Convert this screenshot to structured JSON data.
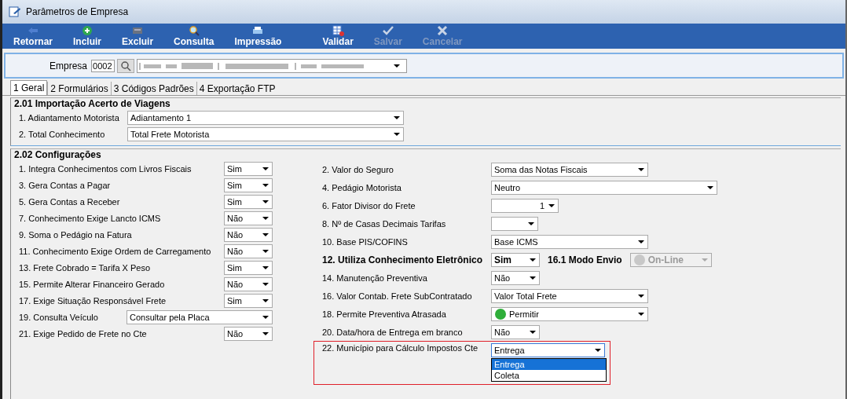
{
  "window": {
    "title": "Parâmetros de Empresa"
  },
  "toolbar": [
    {
      "label": "Retornar",
      "disabled": false
    },
    {
      "label": "Incluir",
      "disabled": false
    },
    {
      "label": "Excluir",
      "disabled": false
    },
    {
      "label": "Consulta",
      "disabled": false
    },
    {
      "label": "Impressão",
      "disabled": false
    },
    {
      "label": "Validar",
      "disabled": false
    },
    {
      "label": "Salvar",
      "disabled": true
    },
    {
      "label": "Cancelar",
      "disabled": true
    }
  ],
  "company": {
    "label": "Empresa",
    "code": "0002"
  },
  "tabs": [
    {
      "label": "1 Geral",
      "selected": true
    },
    {
      "label": "2 Formulários",
      "selected": false
    },
    {
      "label": "3 Códigos Padrões",
      "selected": false
    },
    {
      "label": "4 Exportação FTP",
      "selected": false
    }
  ],
  "import_section": {
    "title": "2.01 Importação Acerto de Viagens",
    "fields": [
      {
        "label": "1. Adiantamento Motorista",
        "value": "Adiantamento 1"
      },
      {
        "label": "2. Total Conhecimento",
        "value": "Total Frete Motorista"
      }
    ]
  },
  "config_section": {
    "title": "2.02 Configurações",
    "left": [
      {
        "label": "1. Integra Conhecimentos com Livros Fiscais",
        "value": "Sim"
      },
      {
        "label": "3. Gera Contas a Pagar",
        "value": "Sim"
      },
      {
        "label": "5. Gera Contas a Receber",
        "value": "Sim"
      },
      {
        "label": "7. Conhecimento Exige Lancto ICMS",
        "value": "Não"
      },
      {
        "label": "9. Soma o Pedágio na Fatura",
        "value": "Não"
      },
      {
        "label": "11. Conhecimento Exige Ordem de Carregamento",
        "value": "Não"
      },
      {
        "label": "13. Frete Cobrado = Tarifa X Peso",
        "value": "Sim"
      },
      {
        "label": "15. Permite Alterar Financeiro Gerado",
        "value": "Não"
      },
      {
        "label": "17. Exige Situação Responsável Frete",
        "value": "Sim"
      },
      {
        "label": "19. Consulta Veículo",
        "value": "Consultar pela Placa"
      },
      {
        "label": "21. Exige Pedido de Frete no Cte",
        "value": "Não"
      }
    ],
    "right": [
      {
        "label": "2. Valor do Seguro",
        "value": "Soma das Notas Fiscais",
        "highlighted": false
      },
      {
        "label": "4. Pedágio Motorista",
        "value": "Neutro",
        "highlighted": false
      },
      {
        "label": "6. Fator Divisor do Frete",
        "value": "1",
        "highlighted": false
      },
      {
        "label": "8. Nº de Casas Decimais Tarifas",
        "highlighted": false
      },
      {
        "label": "10. Base PIS/COFINS",
        "value": "Base ICMS",
        "highlighted": false
      },
      {
        "label": "12. Utiliza Conhecimento Eletrônico",
        "value": "Sim",
        "emphasized": true,
        "highlighted": false,
        "extra": {
          "label": "16.1 Modo Envio",
          "value": "On-Line",
          "disabled": true,
          "lit": false
        }
      },
      {
        "label": "14. Manutenção Preventiva",
        "value": "Não",
        "highlighted": false
      },
      {
        "label": "16. Valor Contab. Frete SubContratado",
        "value": "Valor Total Frete",
        "highlighted": false
      },
      {
        "label": "18. Permite Preventiva Atrasada",
        "value": "Permitir",
        "lit": true,
        "highlighted": false
      },
      {
        "label": "20. Data/hora de Entrega em branco",
        "value": "Não",
        "highlighted": false
      },
      {
        "label": "22. Município para Cálculo Impostos Cte",
        "value": "Entrega",
        "highlighted": true,
        "options": [
          {
            "label": "Entrega",
            "selected": true
          },
          {
            "label": "Coleta",
            "selected": false
          }
        ]
      }
    ]
  }
}
